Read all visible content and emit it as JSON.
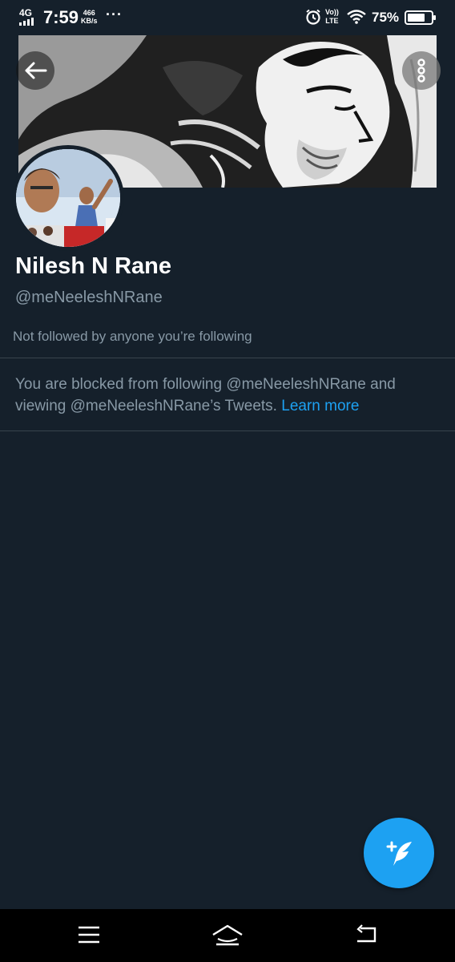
{
  "status_bar": {
    "network": "4G",
    "time": "7:59",
    "speed_value": "466",
    "speed_unit": "KB/s",
    "more_dots": "···",
    "volte_top": "Vo))",
    "volte_bottom": "LTE",
    "battery_percent": "75%",
    "battery_level": 0.75
  },
  "profile": {
    "name": "Nilesh N Rane",
    "handle": "@meNeeleshNRane",
    "followers_note": "Not followed by anyone you’re following"
  },
  "blocked": {
    "message": "You are blocked from following @meNeeleshNRane and viewing @meNeeleshNRane’s Tweets.",
    "link_label": "Learn more"
  },
  "colors": {
    "background": "#15202b",
    "accent": "#1da1f2",
    "secondary_text": "#8899a6",
    "divider": "#38444d"
  },
  "icons": {
    "back": "arrow-left-icon",
    "more": "vertical-dots-icon",
    "compose": "feather-plus-icon",
    "nav_menu": "menu-icon",
    "nav_home": "home-icon",
    "nav_back": "return-icon"
  }
}
